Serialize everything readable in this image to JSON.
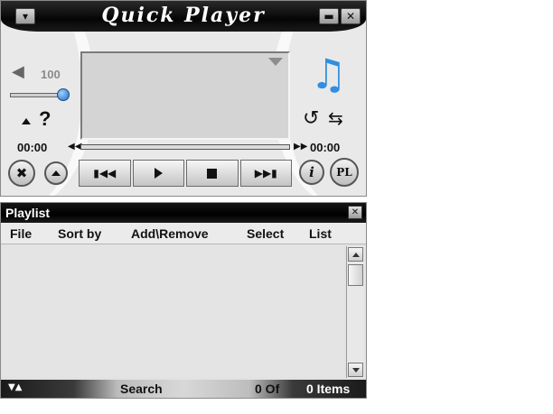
{
  "player": {
    "title": "Quick Player",
    "volume": 100,
    "volume_label": "100",
    "elapsed_time": "00:00",
    "remaining_time": "00:00",
    "pl_button_label": "PL",
    "info_button_label": "i",
    "help_label": "?",
    "accent_color": "#2f8fe0"
  },
  "playlist": {
    "title": "Playlist",
    "menu": [
      "File",
      "Sort by",
      "Add\\Remove",
      "Select",
      "List"
    ],
    "search_label": "Search",
    "position": "0 Of",
    "item_count": "0 Items"
  }
}
